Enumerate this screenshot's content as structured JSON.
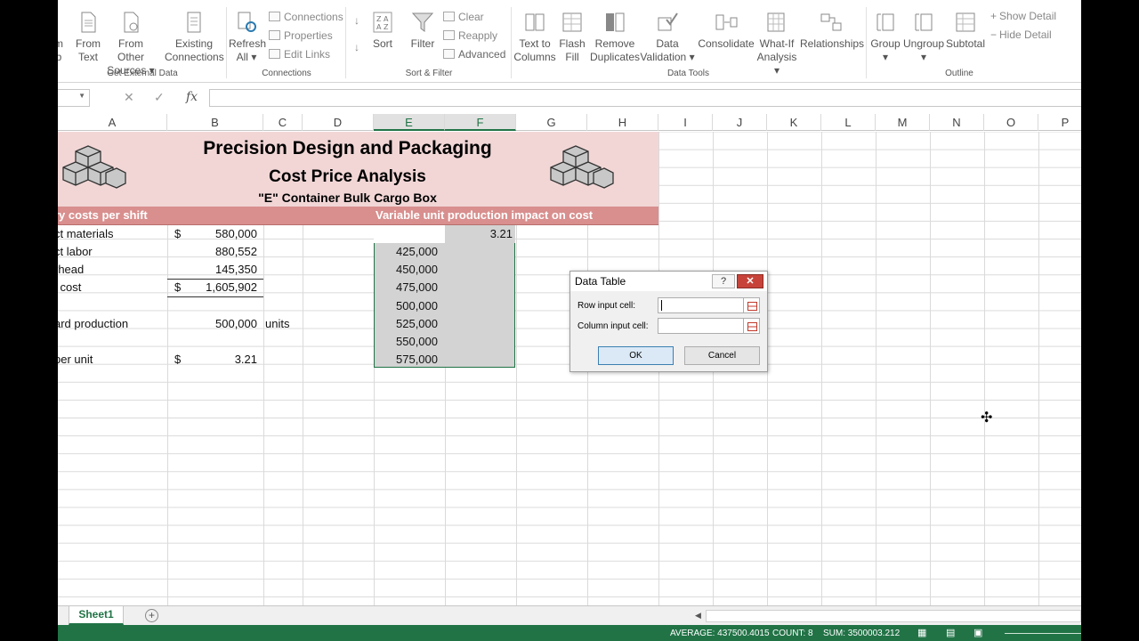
{
  "ribbon": {
    "groups": [
      {
        "label": "Get External Data"
      },
      {
        "label": "Connections"
      },
      {
        "label": "Sort & Filter"
      },
      {
        "label": "Data Tools"
      },
      {
        "label": "Outline"
      }
    ],
    "buttons": {
      "from_web_1": "m",
      "from_web_2": "b",
      "from_text_1": "From",
      "from_text_2": "Text",
      "from_other_1": "From Other",
      "from_other_2": "Sources",
      "existing_1": "Existing",
      "existing_2": "Connections",
      "refresh_1": "Refresh",
      "refresh_2": "All",
      "connections": "Connections",
      "properties": "Properties",
      "edit_links": "Edit Links",
      "sort": "Sort",
      "filter": "Filter",
      "clear": "Clear",
      "reapply": "Reapply",
      "advanced": "Advanced",
      "text_to_cols_1": "Text to",
      "text_to_cols_2": "Columns",
      "flash_1": "Flash",
      "flash_2": "Fill",
      "remove_dup_1": "Remove",
      "remove_dup_2": "Duplicates",
      "validation_1": "Data",
      "validation_2": "Validation",
      "consolidate": "Consolidate",
      "whatif_1": "What-If",
      "whatif_2": "Analysis",
      "relationships": "Relationships",
      "group": "Group",
      "ungroup": "Ungroup",
      "subtotal": "Subtotal",
      "show_detail": "Show Detail",
      "hide_detail": "Hide Detail"
    }
  },
  "formula_bar": {
    "fx": "fx",
    "value": ""
  },
  "columns": [
    "A",
    "B",
    "C",
    "D",
    "E",
    "F",
    "G",
    "H",
    "I",
    "J",
    "K",
    "L",
    "M",
    "N",
    "O",
    "P"
  ],
  "banner": {
    "title": "Precision Design and Packaging",
    "subtitle": "Cost Price Analysis",
    "subtitle2": "\"E\" Container Bulk Cargo Box",
    "left_header": "ry costs per shift",
    "right_header": "Variable unit production impact on cost"
  },
  "rows": [
    {
      "a": "ct materials",
      "b_cur": "$",
      "b": "580,000",
      "c": ""
    },
    {
      "a": "ct labor",
      "b_cur": "",
      "b": "880,552",
      "c": ""
    },
    {
      "a": "rhead",
      "b_cur": "",
      "b": "145,350",
      "c": ""
    },
    {
      "a": "l cost",
      "b_cur": "$",
      "b": "1,605,902",
      "c": ""
    },
    {
      "a": "",
      "b_cur": "",
      "b": "",
      "c": ""
    },
    {
      "a": "ard production",
      "b_cur": "",
      "b": "500,000",
      "c": "units"
    },
    {
      "a": "",
      "b_cur": "",
      "b": "",
      "c": ""
    },
    {
      "a": "per unit",
      "b_cur": "$",
      "b": "3.21",
      "c": ""
    }
  ],
  "table": {
    "f_top": "3.21",
    "e_values": [
      "425,000",
      "450,000",
      "475,000",
      "500,000",
      "525,000",
      "550,000",
      "575,000"
    ]
  },
  "dialog": {
    "title": "Data Table",
    "help": "?",
    "close": "✕",
    "row_label": "Row input cell:",
    "col_label": "Column input cell:",
    "ok": "OK",
    "cancel": "Cancel"
  },
  "sheet_tab": "Sheet1",
  "add_sheet": "+",
  "status": {
    "average": "AVERAGE: 437500.4015",
    "count": "COUNT: 8",
    "sum": "SUM: 3500003.212"
  }
}
